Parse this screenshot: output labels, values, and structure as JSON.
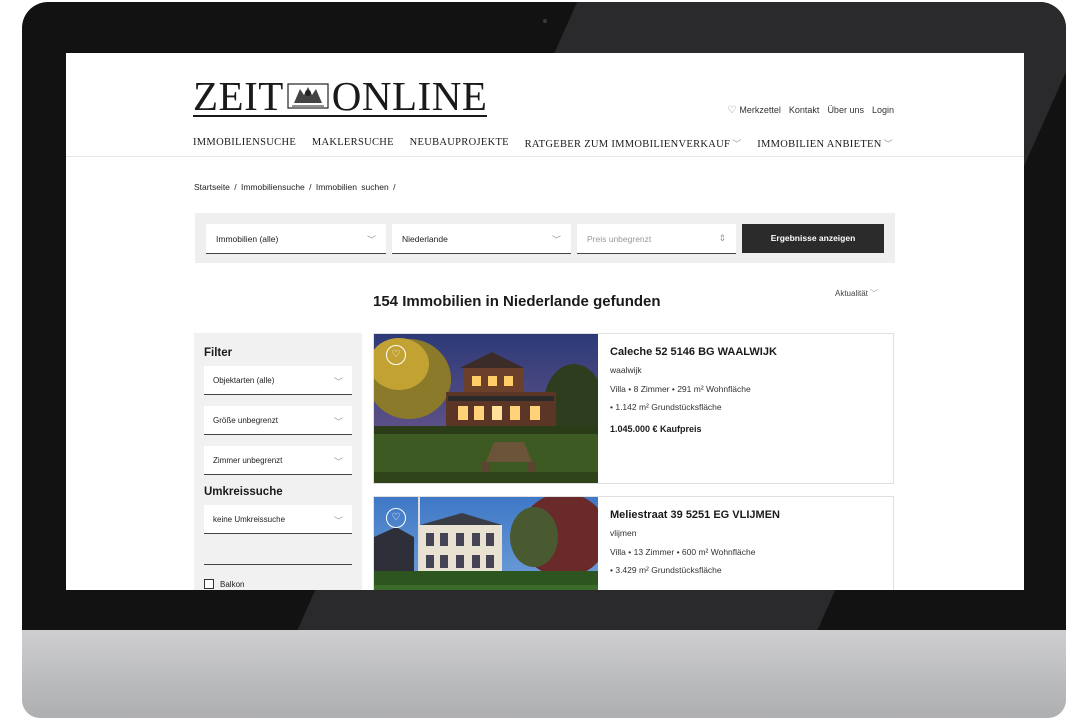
{
  "brand": {
    "logo_left": "ZEIT",
    "logo_right": "ONLINE"
  },
  "header_links": [
    "Merkzettel",
    "Kontakt",
    "Über uns",
    "Login"
  ],
  "nav": [
    {
      "label": "IMMOBILIENSUCHE",
      "dropdown": false
    },
    {
      "label": "MAKLERSUCHE",
      "dropdown": false
    },
    {
      "label": "NEUBAUPROJEKTE",
      "dropdown": false
    },
    {
      "label": "RATGEBER ZUM IMMOBILIENVERKAUF",
      "dropdown": true
    },
    {
      "label": "IMMOBILIEN ANBIETEN",
      "dropdown": true
    }
  ],
  "breadcrumb": "Startseite  /  Immobiliensuche  /  Immobilien suchen  /",
  "search": {
    "type_value": "Immobilien (alle)",
    "location_value": "Niederlande",
    "price_placeholder": "Preis unbegrenzt",
    "submit_label": "Ergebnisse anzeigen"
  },
  "results": {
    "title": "154 Immobilien in Niederlande gefunden",
    "sort_label": "Aktualität"
  },
  "filter": {
    "title": "Filter",
    "object_types": "Objektarten (alle)",
    "size": "Größe unbegrenzt",
    "rooms": "Zimmer unbegrenzt",
    "radius_title": "Umkreissuche",
    "radius_value": "keine Umkreissuche",
    "balcony_label": "Balkon"
  },
  "listings": [
    {
      "address": "Caleche 52 5146 BG WAALWIJK",
      "city": "waalwijk",
      "features1": "Villa • 8 Zimmer • 291 m² Wohnfläche",
      "features2": "• 1.142 m² Grundstücksfläche",
      "price": "1.045.000 € Kaufpreis"
    },
    {
      "address": "Meliestraat 39 5251 EG VLIJMEN",
      "city": "vlijmen",
      "features1": "Villa • 13 Zimmer • 600 m² Wohnfläche",
      "features2": "• 3.429 m² Grundstücksfläche",
      "price": ""
    }
  ],
  "colors": {
    "accent_dark": "#2b2b2b",
    "panel_grey": "#efefef"
  }
}
